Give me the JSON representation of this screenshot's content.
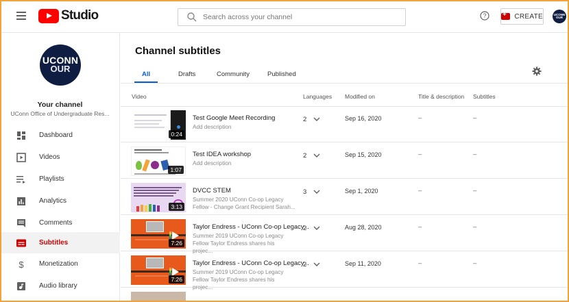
{
  "header": {
    "logo_text": "Studio",
    "search_placeholder": "Search across your channel",
    "create_label": "CREATE",
    "avatar_text_1": "UCONN",
    "avatar_text_2": "OUR"
  },
  "sidebar": {
    "avatar_text_1": "UCONN",
    "avatar_text_2": "OUR",
    "channel_title": "Your channel",
    "channel_name": "UConn Office of Undergraduate Res...",
    "items": [
      {
        "label": "Dashboard",
        "icon": "dashboard-icon"
      },
      {
        "label": "Videos",
        "icon": "videos-icon"
      },
      {
        "label": "Playlists",
        "icon": "playlists-icon"
      },
      {
        "label": "Analytics",
        "icon": "analytics-icon"
      },
      {
        "label": "Comments",
        "icon": "comments-icon"
      },
      {
        "label": "Subtitles",
        "icon": "subtitles-icon",
        "active": true
      },
      {
        "label": "Monetization",
        "icon": "monetization-icon"
      },
      {
        "label": "Audio library",
        "icon": "audio-library-icon"
      }
    ]
  },
  "main": {
    "title": "Channel subtitles",
    "tabs": [
      "All",
      "Drafts",
      "Community",
      "Published"
    ],
    "columns": [
      "Video",
      "Languages",
      "Modified on",
      "Title & description",
      "Subtitles"
    ],
    "rows": [
      {
        "title": "Test Google Meet Recording",
        "desc": "Add description",
        "duration": "0:24",
        "languages": "2",
        "modified": "Sep 16, 2020",
        "title_desc": "–",
        "subtitles": "–"
      },
      {
        "title": "Test IDEA workshop",
        "desc": "Add description",
        "duration": "1:07",
        "languages": "2",
        "modified": "Sep 15, 2020",
        "title_desc": "–",
        "subtitles": "–"
      },
      {
        "title": "DVCC STEM",
        "desc": "Summer 2020 UConn Co-op Legacy Fellow - Change Grant Recipient Sarah...",
        "duration": "3:13",
        "languages": "3",
        "modified": "Sep 1, 2020",
        "title_desc": "–",
        "subtitles": "–"
      },
      {
        "title": "Taylor Endress - UConn Co-op Legacy...",
        "desc": "Summer 2019 UConn Co-op Legacy Fellow Taylor Endress shares his projec...",
        "duration": "7:26",
        "languages": "2",
        "modified": "Aug 28, 2020",
        "title_desc": "–",
        "subtitles": "–"
      },
      {
        "title": "Taylor Endress - UConn Co-op Legacy...",
        "desc": "Summer 2019 UConn Co-op Legacy Fellow Taylor Endress shares his projec...",
        "duration": "7:26",
        "languages": "2",
        "modified": "Sep 11, 2020",
        "title_desc": "–",
        "subtitles": "–"
      }
    ]
  },
  "colors": {
    "accent_red": "#cc0000",
    "tab_blue": "#0a5bd5",
    "brand_navy": "#0e1d41",
    "frame_orange": "#f2a33a"
  }
}
